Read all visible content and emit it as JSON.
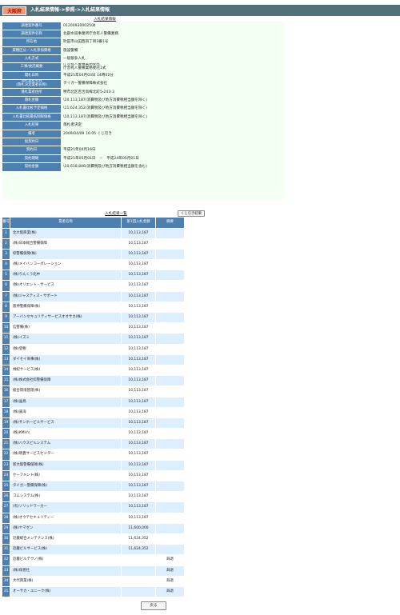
{
  "header": {
    "logo_text": "大阪府",
    "title": "入札結果情報->参照->入札結果情報"
  },
  "detail": {
    "section_title": "入札結果情報",
    "rows": [
      {
        "label": "調達案件番号",
        "value": "0120093000250Ⅱ"
      },
      {
        "label": "調達案件名称",
        "value": "北部水道事業所庁舎有人警備業務"
      },
      {
        "label": "所在地",
        "value": "吹田市山田西四丁目3番1号"
      },
      {
        "label": "業種区分／入札参加資格",
        "value": "施設警備"
      },
      {
        "label": "入札方式",
        "value": "一般競争入札"
      },
      {
        "label": "工事/委託概要",
        "value": "庁舎有人警備業務委託\n庁舎有人警備業務委託1式"
      },
      {
        "label": "開札日時",
        "value": "平成21年04月03日 14時02分"
      },
      {
        "label": "落札業者名称\n(落札決定業者名称)",
        "value": "タイガー警備保障株式会社"
      },
      {
        "label": "落札業者住所",
        "value": "堺市北区百舌鳥梅北町5-243-3"
      },
      {
        "label": "落札金額",
        "value": "\\10,113,187(消費税及び地方消費税相当額を除く)"
      },
      {
        "label": "入札書比較予定価格",
        "value": "\\11,624,352(消費税及び地方消費税相当額を除く)"
      },
      {
        "label": "入札書比較最低制限価格",
        "value": "\\10,113,187(消費税及び地方消費税相当額を除く)"
      },
      {
        "label": "入札結果",
        "value": "落札者決定"
      },
      {
        "label": "備考",
        "value": "2009/04/09 16:05 くじ引き"
      },
      {
        "label": "仮契約日",
        "value": ""
      },
      {
        "label": "契約日",
        "value": "平成21年04月16日"
      },
      {
        "label": "契約期間",
        "value": "平成21年05月01日　－　平成24年05月01日"
      },
      {
        "label": "契約金額",
        "value": "\\10,618,846(消費税及び地方消費税相当額を含む)"
      }
    ]
  },
  "results": {
    "title": "入札結果一覧",
    "lottery_button": "くじ引き結果",
    "headers": {
      "no": "番号",
      "name": "業者名称",
      "amount": "第1回入札金額",
      "remarks": "摘要"
    },
    "rows": [
      {
        "no": "1",
        "name": "北大阪興業(株)",
        "amount": "10,113,187",
        "remarks": ""
      },
      {
        "no": "2",
        "name": "(株)日本総合警備保障",
        "amount": "10,113,187",
        "remarks": ""
      },
      {
        "no": "3",
        "name": "綜警備保障(株)",
        "amount": "10,113,187",
        "remarks": ""
      },
      {
        "no": "4",
        "name": "(株)メイバンコーポレーション",
        "amount": "10,113,187",
        "remarks": ""
      },
      {
        "no": "5",
        "name": "(株)りんくう北中",
        "amount": "10,113,187",
        "remarks": ""
      },
      {
        "no": "6",
        "name": "(株)オリエント・サービス",
        "amount": "10,113,187",
        "remarks": ""
      },
      {
        "no": "7",
        "name": "(株)ジャスティス・サポート",
        "amount": "10,113,187",
        "remarks": ""
      },
      {
        "no": "8",
        "name": "阪神警備保障(株)",
        "amount": "10,113,187",
        "remarks": ""
      },
      {
        "no": "9",
        "name": "アーバンセキュリティサービスオオサカ(株)",
        "amount": "10,113,187",
        "remarks": ""
      },
      {
        "no": "10",
        "name": "信警備(株)",
        "amount": "10,113,187",
        "remarks": ""
      },
      {
        "no": "11",
        "name": "(株)イズミ",
        "amount": "10,113,187",
        "remarks": ""
      },
      {
        "no": "12",
        "name": "(株)登樹",
        "amount": "10,113,187",
        "remarks": ""
      },
      {
        "no": "13",
        "name": "ダイセイ商事(株)",
        "amount": "10,113,187",
        "remarks": ""
      },
      {
        "no": "14",
        "name": "林紀サービス(株)",
        "amount": "10,113,187",
        "remarks": ""
      },
      {
        "no": "15",
        "name": "(株)株式会社綜警備保障",
        "amount": "10,113,187",
        "remarks": ""
      },
      {
        "no": "16",
        "name": "総合環境管理(株)",
        "amount": "10,113,187",
        "remarks": ""
      },
      {
        "no": "17",
        "name": "(株)画鳥",
        "amount": "10,113,187",
        "remarks": ""
      },
      {
        "no": "18",
        "name": "(株)嵐海",
        "amount": "10,113,187",
        "remarks": ""
      },
      {
        "no": "19",
        "name": "(株)サンホービルサービス",
        "amount": "10,113,187",
        "remarks": ""
      },
      {
        "no": "20",
        "name": "(株)KMH's",
        "amount": "10,113,187",
        "remarks": ""
      },
      {
        "no": "21",
        "name": "(株)ハウスビルシステム",
        "amount": "10,113,187",
        "remarks": ""
      },
      {
        "no": "22",
        "name": "(株)明豊サービスセンター",
        "amount": "10,113,187",
        "remarks": ""
      },
      {
        "no": "23",
        "name": "新大阪警備保障(株)",
        "amount": "10,113,187",
        "remarks": ""
      },
      {
        "no": "24",
        "name": "セーフメント(株)",
        "amount": "10,113,187",
        "remarks": ""
      },
      {
        "no": "25",
        "name": "タイガー警備保障(株)",
        "amount": "10,113,187",
        "remarks": ""
      },
      {
        "no": "26",
        "name": "コムシステム(株)",
        "amount": "10,113,187",
        "remarks": ""
      },
      {
        "no": "27",
        "name": "(有)ソリッドワーカー",
        "amount": "10,113,187",
        "remarks": ""
      },
      {
        "no": "28",
        "name": "(株)オウテセキュリティー",
        "amount": "10,113,187",
        "remarks": ""
      },
      {
        "no": "29",
        "name": "(株)ヤマゼン",
        "amount": "11,600,000",
        "remarks": ""
      },
      {
        "no": "30",
        "name": "近畿総合メンテナンス(株)",
        "amount": "11,624,352",
        "remarks": ""
      },
      {
        "no": "31",
        "name": "近畿ビルサービス(株)",
        "amount": "11,624,352",
        "remarks": ""
      },
      {
        "no": "32",
        "name": "近畿ビルテクノ(株)",
        "amount": "",
        "remarks": "辞退"
      },
      {
        "no": "33",
        "name": "(株)保善社",
        "amount": "",
        "remarks": "辞退"
      },
      {
        "no": "34",
        "name": "大代興業(株)",
        "amount": "",
        "remarks": "辞退"
      },
      {
        "no": "35",
        "name": "オーサカ・ユニーク(株)",
        "amount": "",
        "remarks": "辞退"
      }
    ]
  },
  "footer": {
    "back_button": "戻る"
  }
}
